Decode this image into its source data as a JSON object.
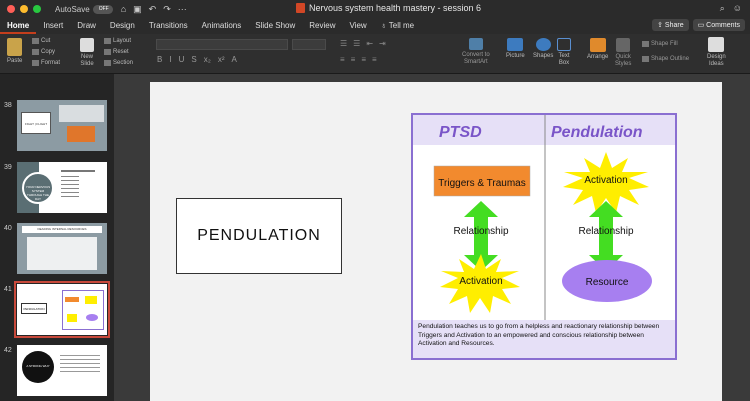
{
  "window": {
    "autosave_label": "AutoSave",
    "autosave_state": "OFF",
    "doc_title": "Nervous system health mastery - session 6"
  },
  "tabs": [
    "Home",
    "Insert",
    "Draw",
    "Design",
    "Transitions",
    "Animations",
    "Slide Show",
    "Review",
    "View"
  ],
  "tell_me": "Tell me",
  "share_label": "Share",
  "comments_label": "Comments",
  "ribbon": {
    "paste": "Paste",
    "cut": "Cut",
    "copy": "Copy",
    "format": "Format",
    "new_slide": "New\nSlide",
    "layout": "Layout",
    "reset": "Reset",
    "section": "Section",
    "convert": "Convert to\nSmartArt",
    "picture": "Picture",
    "shapes": "Shapes",
    "text_box": "Text\nBox",
    "arrange": "Arrange",
    "quick_styles": "Quick\nStyles",
    "shape_fill": "Shape Fill",
    "shape_outline": "Shape Outline",
    "design_ideas": "Design\nIdeas"
  },
  "thumbnails": [
    {
      "num": "38",
      "text": "FIGHT | FLIGHT"
    },
    {
      "num": "39",
      "text": "YOUR NERVOUS SYSTEM THROUGH THE DAY"
    },
    {
      "num": "40",
      "text": "DEADING INTERNAL RESOURCES"
    },
    {
      "num": "41",
      "text": "PENDULATION"
    },
    {
      "num": "42",
      "text": "A STRONG WHY"
    }
  ],
  "slide": {
    "title": "PENDULATION",
    "left_header": "PTSD",
    "right_header": "Pendulation",
    "triggers": "Triggers & Traumas",
    "relationship": "Relationship",
    "activation": "Activation",
    "resource": "Resource",
    "caption": "Pendulation teaches us to go from a helpless and reactionary relationship between Triggers and Activation to an empowered and conscious relationship between Activation and Resources."
  },
  "colors": {
    "accent": "#c43e1c",
    "purple_border": "#8a6fd1",
    "header_bg": "#e6e0f7",
    "orange": "#f28a2e",
    "star_yellow": "#ffee00",
    "arrow_green": "#44dd22",
    "resource_purple": "#a77ff0"
  }
}
